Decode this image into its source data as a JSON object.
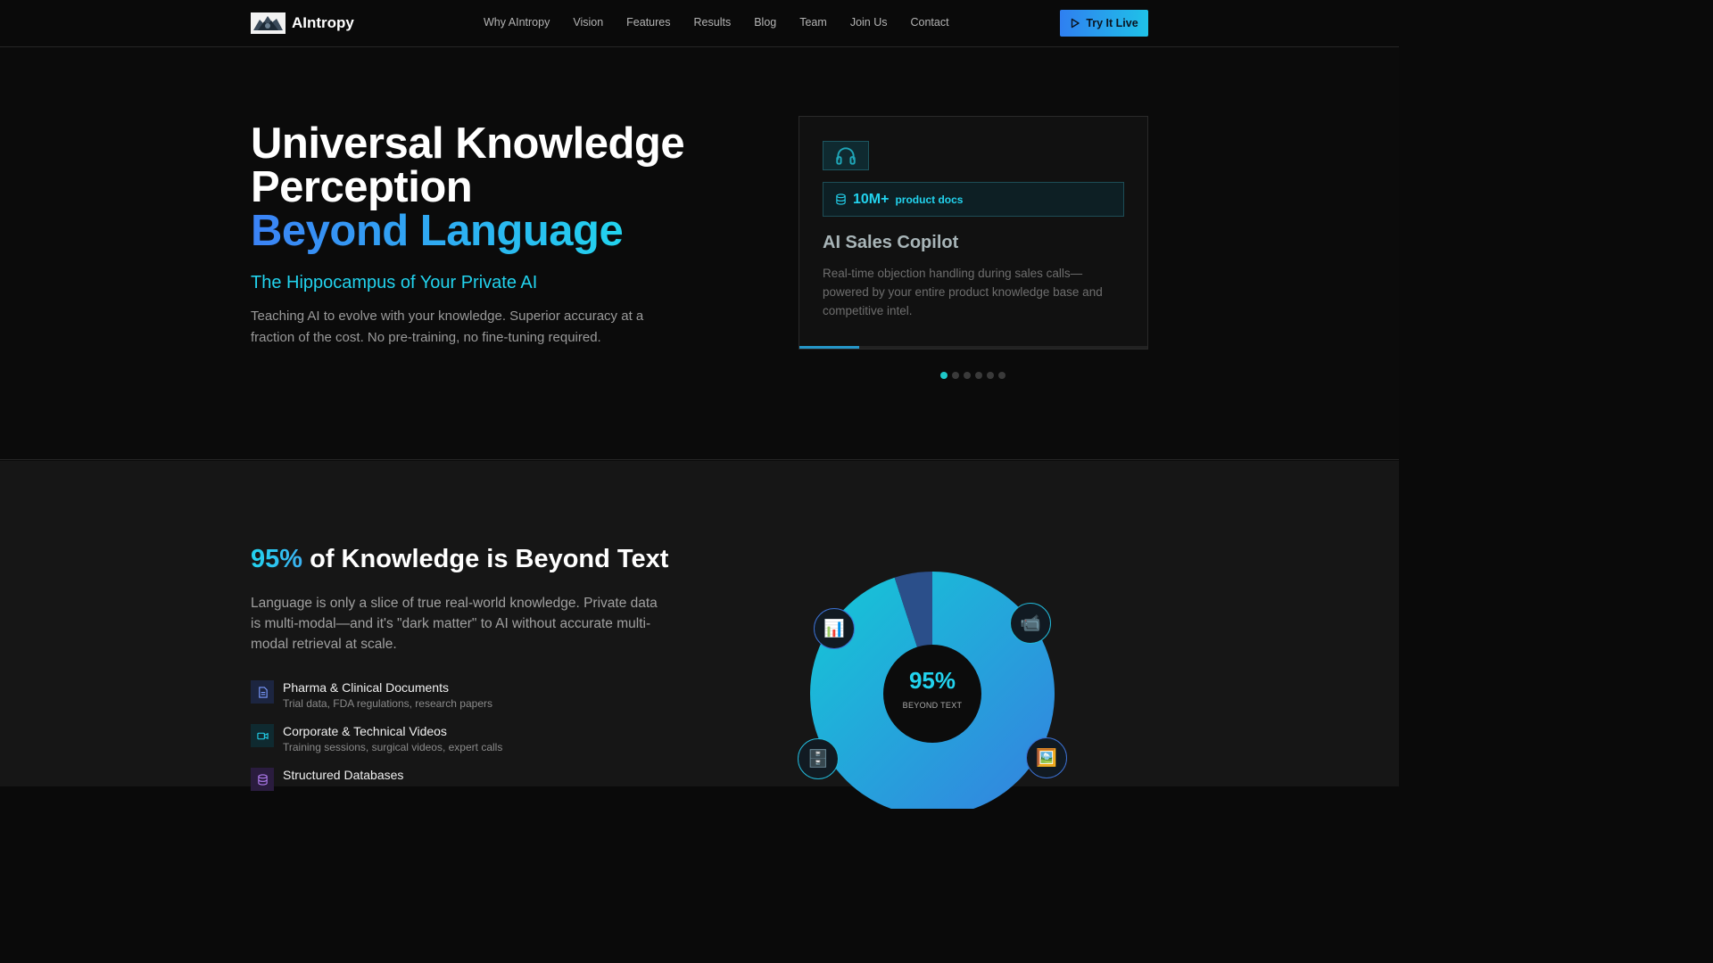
{
  "nav": {
    "brand": "AIntropy",
    "links": [
      "Why AIntropy",
      "Vision",
      "Features",
      "Results",
      "Blog",
      "Team",
      "Join Us",
      "Contact"
    ],
    "cta": "Try It Live"
  },
  "hero": {
    "title_line1": "Universal Knowledge",
    "title_line2": "Perception",
    "title_line3": "Beyond Language",
    "subtitle": "The Hippocampus of Your Private AI",
    "description": "Teaching AI to evolve with your knowledge. Superior accuracy at a fraction of the cost. No pre-training, no fine-tuning required."
  },
  "card": {
    "icon": "headset-icon",
    "stat_icon": "database-icon",
    "stat_value": "10M+",
    "stat_label": "product docs",
    "title": "AI Sales Copilot",
    "description": "Real-time objection handling during sales calls—powered by your entire product knowledge base and competitive intel.",
    "progress": 0.17,
    "slide_count": 6,
    "active_slide": 0
  },
  "section2": {
    "title_accent": "95%",
    "title_rest": " of Knowledge is Beyond Text",
    "description": "Language is only a slice of true real-world knowledge. Private data is multi-modal—and it's \"dark matter\" to AI without accurate multi-modal retrieval at scale.",
    "features": [
      {
        "icon": "document-icon",
        "title": "Pharma & Clinical Documents",
        "sub": "Trial data, FDA regulations, research papers",
        "color": "#7b9cff",
        "bg": "#1c2540"
      },
      {
        "icon": "video-icon",
        "title": "Corporate & Technical Videos",
        "sub": "Training sessions, surgical videos, expert calls",
        "color": "#22d3ee",
        "bg": "#0f2a30"
      },
      {
        "icon": "database-icon",
        "title": "Structured Databases",
        "sub": "",
        "color": "#b07cf0",
        "bg": "#2a1c3e"
      }
    ],
    "donut": {
      "center_value": "95%",
      "center_label": "BEYOND TEXT",
      "beyond_text_pct": 95,
      "text_pct": 5,
      "colors": {
        "beyond": "#22d3ee",
        "text": "#2b4f8a"
      },
      "orbs": [
        "bar-chart-icon",
        "video-camera-icon",
        "file-cabinet-icon",
        "picture-icon"
      ]
    }
  }
}
